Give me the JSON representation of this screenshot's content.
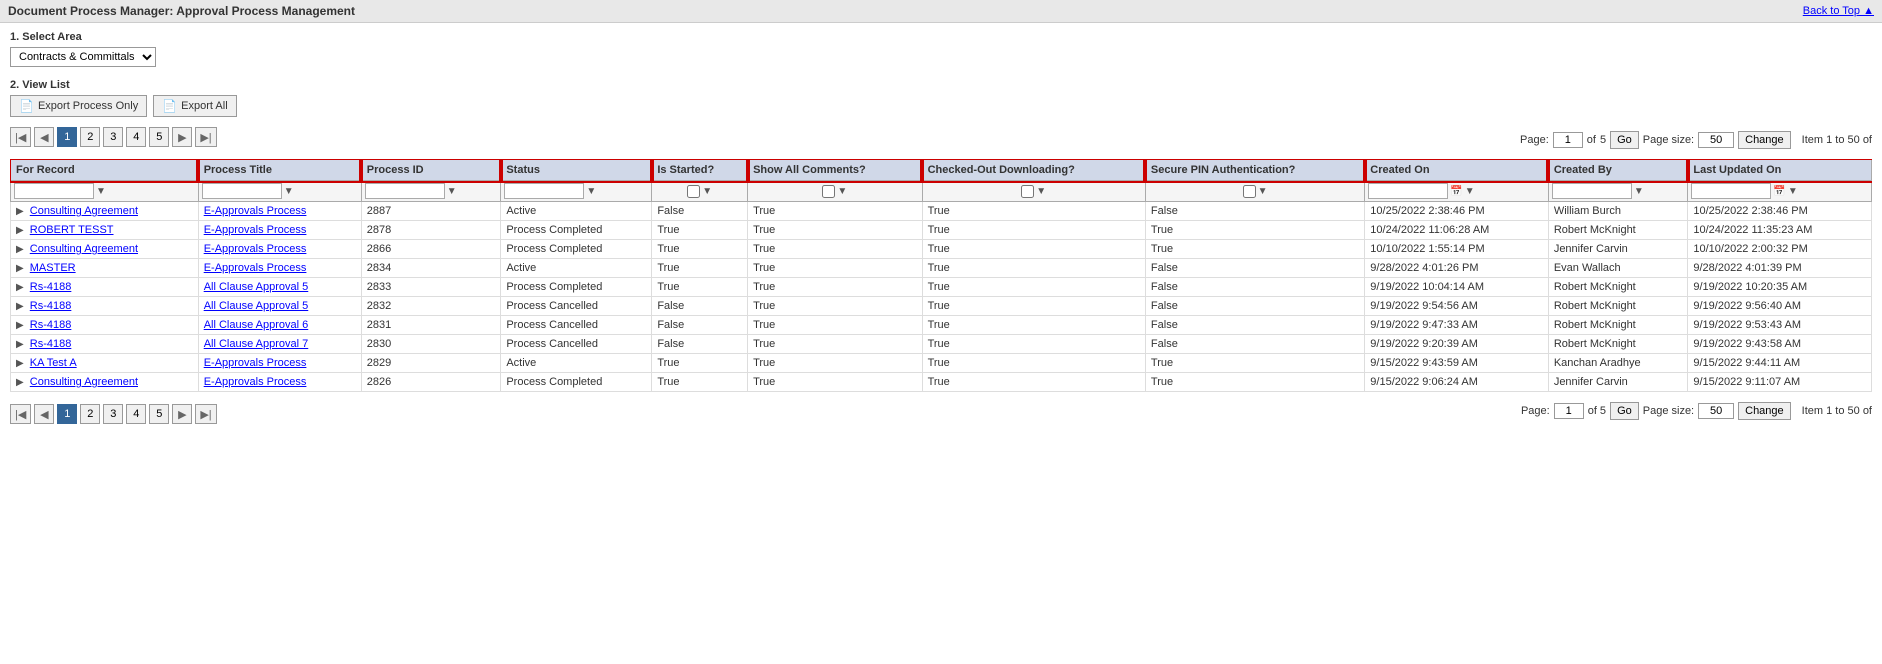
{
  "app": {
    "title": "Document Process Manager: Approval Process Management",
    "back_to_top": "Back to Top ▲"
  },
  "section1": {
    "label": "1. Select Area",
    "dropdown_value": "Contracts & Committals",
    "dropdown_options": [
      "Contracts & Committals"
    ]
  },
  "section2": {
    "label": "2. View List"
  },
  "toolbar": {
    "export_process_only": "Export Process Only",
    "export_all": "Export All"
  },
  "pagination": {
    "current_page": "1",
    "total_pages": "5",
    "page_size": "50",
    "items_info": "Item 1 to 50 of",
    "pages": [
      "1",
      "2",
      "3",
      "4",
      "5"
    ]
  },
  "table": {
    "headers": [
      "For Record",
      "Process Title",
      "Process ID",
      "Status",
      "Is Started?",
      "Show All Comments?",
      "Checked-Out Downloading?",
      "Secure PIN Authentication?",
      "Created On",
      "Created By",
      "Last Updated On"
    ],
    "rows": [
      {
        "for_record": "Consulting Agreement",
        "process_title": "E-Approvals Process",
        "process_id": "2887",
        "status": "Active",
        "is_started": "False",
        "show_all_comments": "True",
        "checked_out": "True",
        "secure_pin": "False",
        "created_on": "10/25/2022 2:38:46 PM",
        "created_by": "William Burch",
        "last_updated_on": "10/25/2022 2:38:46 PM"
      },
      {
        "for_record": "ROBERT TESST",
        "process_title": "E-Approvals Process",
        "process_id": "2878",
        "status": "Process Completed",
        "is_started": "True",
        "show_all_comments": "True",
        "checked_out": "True",
        "secure_pin": "True",
        "created_on": "10/24/2022 11:06:28 AM",
        "created_by": "Robert McKnight",
        "last_updated_on": "10/24/2022 11:35:23 AM"
      },
      {
        "for_record": "Consulting Agreement",
        "process_title": "E-Approvals Process",
        "process_id": "2866",
        "status": "Process Completed",
        "is_started": "True",
        "show_all_comments": "True",
        "checked_out": "True",
        "secure_pin": "True",
        "created_on": "10/10/2022 1:55:14 PM",
        "created_by": "Jennifer Carvin",
        "last_updated_on": "10/10/2022 2:00:32 PM"
      },
      {
        "for_record": "MASTER",
        "process_title": "E-Approvals Process",
        "process_id": "2834",
        "status": "Active",
        "is_started": "True",
        "show_all_comments": "True",
        "checked_out": "True",
        "secure_pin": "False",
        "created_on": "9/28/2022 4:01:26 PM",
        "created_by": "Evan Wallach",
        "last_updated_on": "9/28/2022 4:01:39 PM"
      },
      {
        "for_record": "Rs-4188",
        "process_title": "All Clause Approval 5",
        "process_id": "2833",
        "status": "Process Completed",
        "is_started": "True",
        "show_all_comments": "True",
        "checked_out": "True",
        "secure_pin": "False",
        "created_on": "9/19/2022 10:04:14 AM",
        "created_by": "Robert McKnight",
        "last_updated_on": "9/19/2022 10:20:35 AM"
      },
      {
        "for_record": "Rs-4188",
        "process_title": "All Clause Approval 5",
        "process_id": "2832",
        "status": "Process Cancelled",
        "is_started": "False",
        "show_all_comments": "True",
        "checked_out": "True",
        "secure_pin": "False",
        "created_on": "9/19/2022 9:54:56 AM",
        "created_by": "Robert McKnight",
        "last_updated_on": "9/19/2022 9:56:40 AM"
      },
      {
        "for_record": "Rs-4188",
        "process_title": "All Clause Approval 6",
        "process_id": "2831",
        "status": "Process Cancelled",
        "is_started": "False",
        "show_all_comments": "True",
        "checked_out": "True",
        "secure_pin": "False",
        "created_on": "9/19/2022 9:47:33 AM",
        "created_by": "Robert McKnight",
        "last_updated_on": "9/19/2022 9:53:43 AM"
      },
      {
        "for_record": "Rs-4188",
        "process_title": "All Clause Approval 7",
        "process_id": "2830",
        "status": "Process Cancelled",
        "is_started": "False",
        "show_all_comments": "True",
        "checked_out": "True",
        "secure_pin": "False",
        "created_on": "9/19/2022 9:20:39 AM",
        "created_by": "Robert McKnight",
        "last_updated_on": "9/19/2022 9:43:58 AM"
      },
      {
        "for_record": "KA Test A",
        "process_title": "E-Approvals Process",
        "process_id": "2829",
        "status": "Active",
        "is_started": "True",
        "show_all_comments": "True",
        "checked_out": "True",
        "secure_pin": "True",
        "created_on": "9/15/2022 9:43:59 AM",
        "created_by": "Kanchan Aradhye",
        "last_updated_on": "9/15/2022 9:44:11 AM"
      },
      {
        "for_record": "Consulting Agreement",
        "process_title": "E-Approvals Process",
        "process_id": "2826",
        "status": "Process Completed",
        "is_started": "True",
        "show_all_comments": "True",
        "checked_out": "True",
        "secure_pin": "True",
        "created_on": "9/15/2022 9:06:24 AM",
        "created_by": "Jennifer Carvin",
        "last_updated_on": "9/15/2022 9:11:07 AM"
      }
    ]
  }
}
